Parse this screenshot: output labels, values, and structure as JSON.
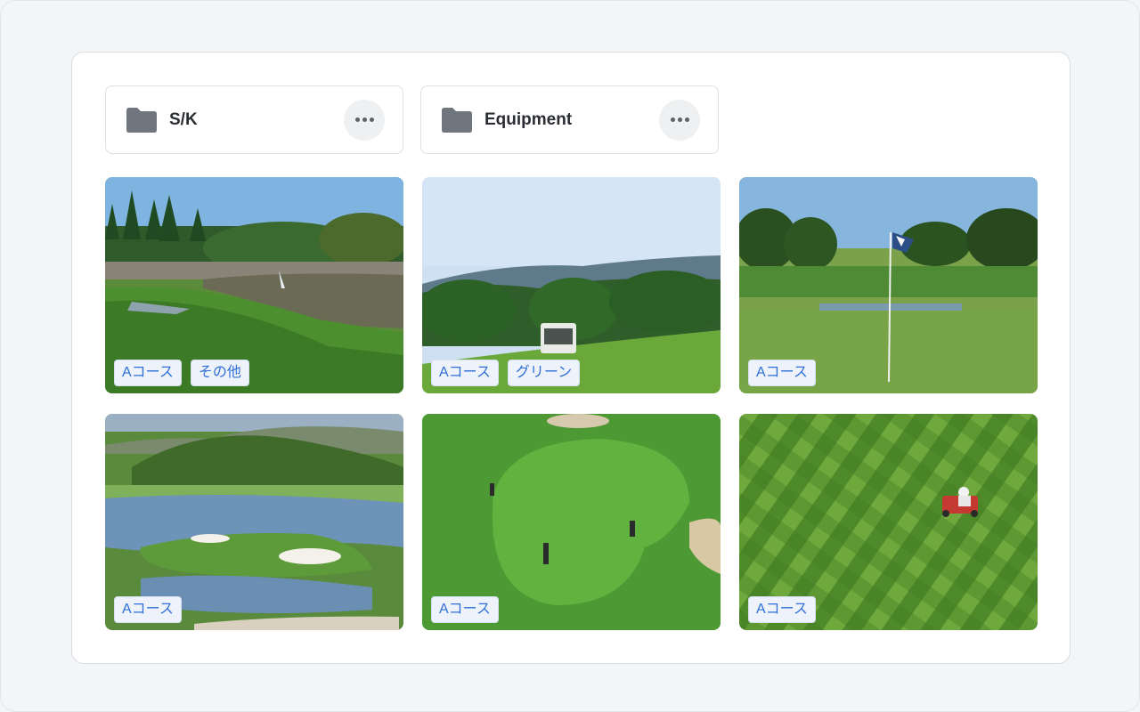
{
  "folders": [
    {
      "name": "S/K",
      "icon": "folder-icon",
      "menu_icon": "more-icon"
    },
    {
      "name": "Equipment",
      "icon": "folder-icon",
      "menu_icon": "more-icon"
    }
  ],
  "photos": [
    {
      "scene": "golf course with pond and fountain, pine trees",
      "tags": [
        "Aコース",
        "その他"
      ]
    },
    {
      "scene": "golf cart on fairway with forested hills",
      "tags": [
        "Aコース",
        "グリーン"
      ]
    },
    {
      "scene": "putting green with flag and trees",
      "tags": [
        "Aコース"
      ]
    },
    {
      "scene": "aerial view of island green surrounded by water",
      "tags": [
        "Aコース"
      ]
    },
    {
      "scene": "aerial view of putting green with golfers and bunkers",
      "tags": [
        "Aコース"
      ]
    },
    {
      "scene": "aerial view of mower on striped lawn",
      "tags": [
        "Aコース"
      ]
    }
  ],
  "colors": {
    "tag_text": "#2f6fd6",
    "tag_bg": "#eef3fb",
    "folder_icon": "#6f767d",
    "panel_bg": "#ffffff",
    "page_bg": "#f4f5f7"
  }
}
